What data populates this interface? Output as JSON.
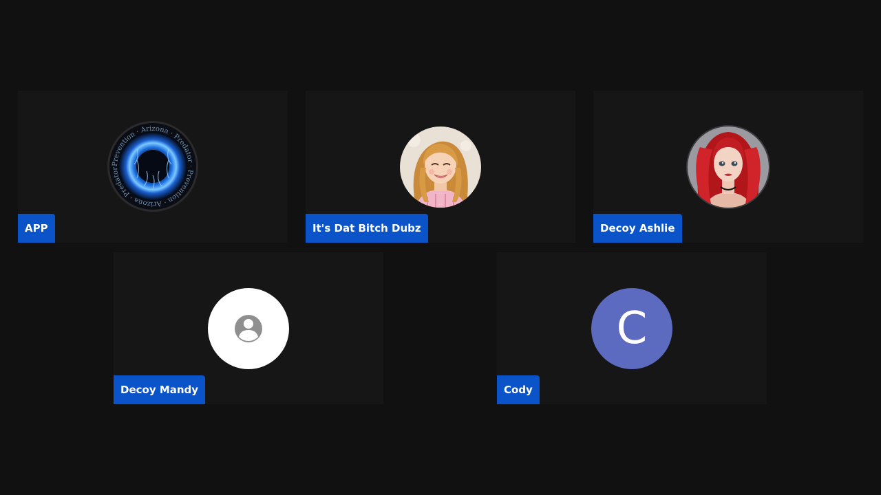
{
  "participants": [
    {
      "name": "APP",
      "avatar": "flame-ring-logo-avatar"
    },
    {
      "name": "It's Dat Bitch Dubz",
      "avatar": "cartoon-girl-photo-avatar"
    },
    {
      "name": "Decoy Ashlie",
      "avatar": "red-haired-girl-photo-avatar"
    },
    {
      "name": "Decoy Mandy",
      "avatar": "default-person-icon"
    },
    {
      "name": "Cody",
      "avatar": "initial-letter-avatar",
      "initial": "C"
    }
  ],
  "logo_ring_text": "Prevention · Arizona · Predator · Prevention · Arizona · Predator",
  "colors": {
    "background": "#111112",
    "tile": "#161617",
    "name_tag": "#0b53c9",
    "initial_avatar": "#5c6bc0"
  }
}
